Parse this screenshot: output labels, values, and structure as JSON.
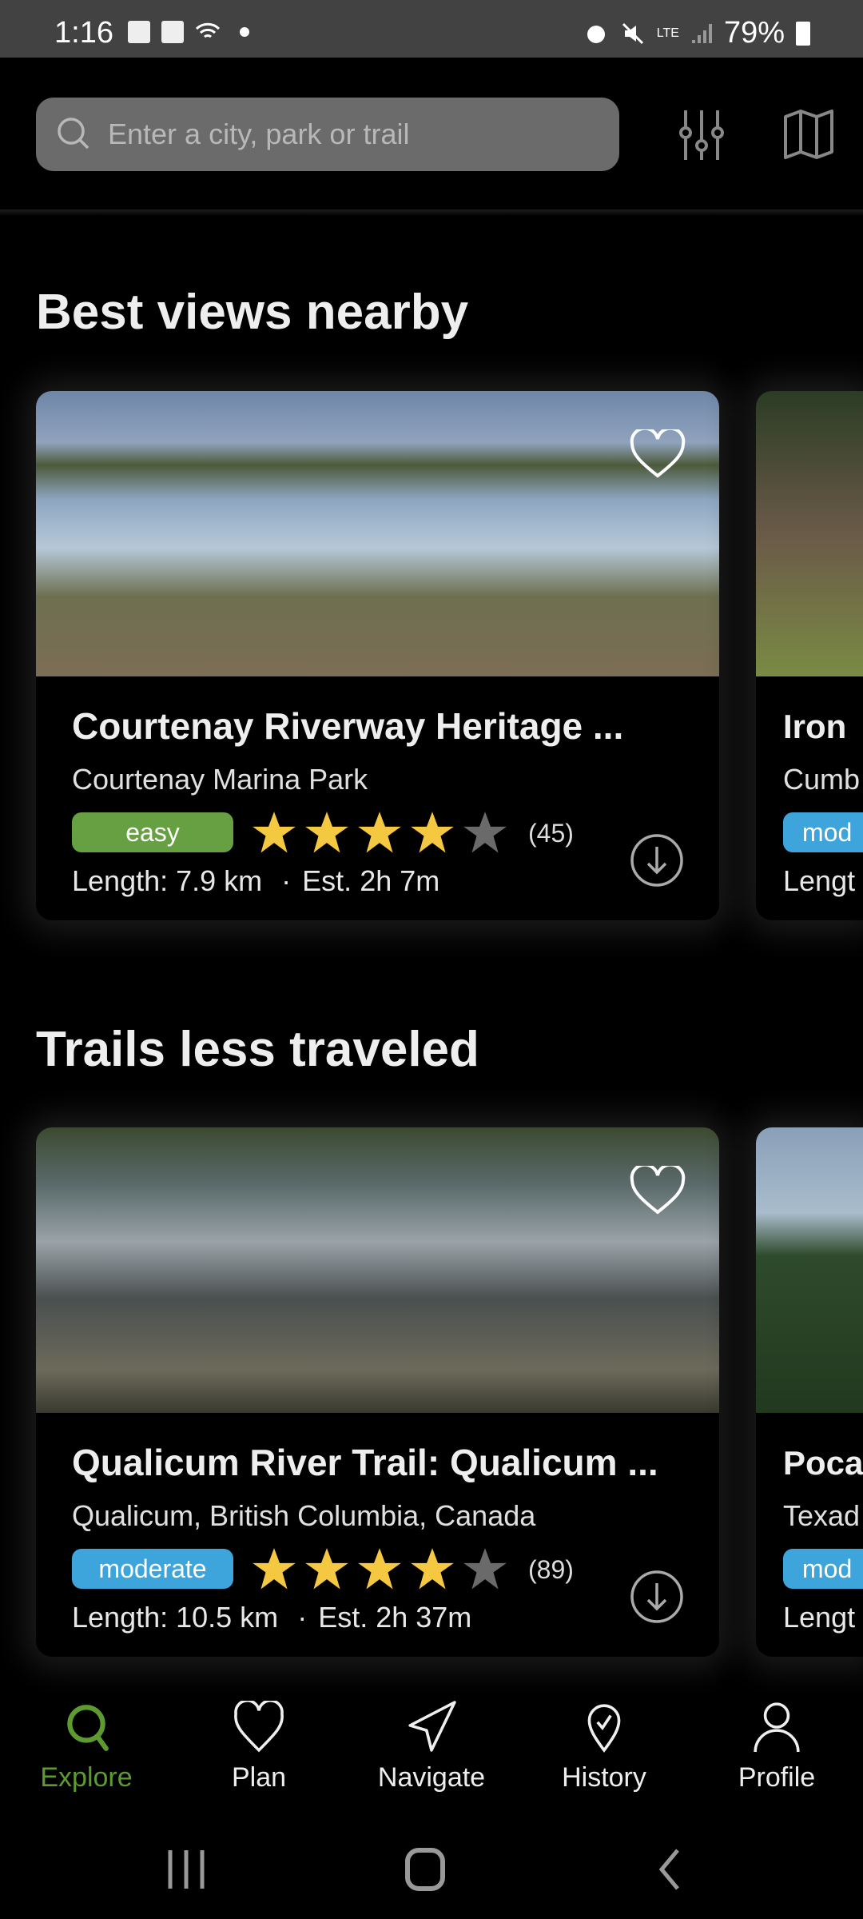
{
  "status_bar": {
    "time": "1:16",
    "network": "LTE",
    "battery": "79%"
  },
  "search": {
    "placeholder": "Enter a city, park or trail"
  },
  "toolbar": {
    "filter_icon": "sliders-icon",
    "map_icon": "map-icon"
  },
  "colors": {
    "accent": "#5d9a30",
    "easy": "#66a042",
    "moderate": "#3ea5dc",
    "star": "#f5c842",
    "star_empty": "#6a6a6a"
  },
  "sections": [
    {
      "title": "Best views nearby",
      "cards": [
        {
          "title": "Courtenay Riverway Heritage ...",
          "subtitle": "Courtenay Marina Park",
          "difficulty": "easy",
          "rating": 4,
          "reviews": "(45)",
          "length": "Length: 7.9 km",
          "sep": "·",
          "est": "Est. 2h 7m"
        },
        {
          "title": "Iron",
          "subtitle": "Cumb",
          "difficulty": "mod",
          "length": "Lengt"
        }
      ]
    },
    {
      "title": "Trails less traveled",
      "cards": [
        {
          "title": "Qualicum River Trail: Qualicum ...",
          "subtitle": "Qualicum, British Columbia, Canada",
          "difficulty": "moderate",
          "rating": 4,
          "reviews": "(89)",
          "length": "Length: 10.5 km",
          "sep": "·",
          "est": "Est. 2h 37m"
        },
        {
          "title": "Poca",
          "subtitle": "Texad",
          "difficulty": "mod",
          "length": "Lengt"
        }
      ]
    }
  ],
  "bottom_nav": [
    {
      "label": "Explore",
      "icon": "search-icon",
      "active": true
    },
    {
      "label": "Plan",
      "icon": "heart-icon"
    },
    {
      "label": "Navigate",
      "icon": "navigate-icon"
    },
    {
      "label": "History",
      "icon": "history-check-icon"
    },
    {
      "label": "Profile",
      "icon": "profile-icon"
    }
  ]
}
